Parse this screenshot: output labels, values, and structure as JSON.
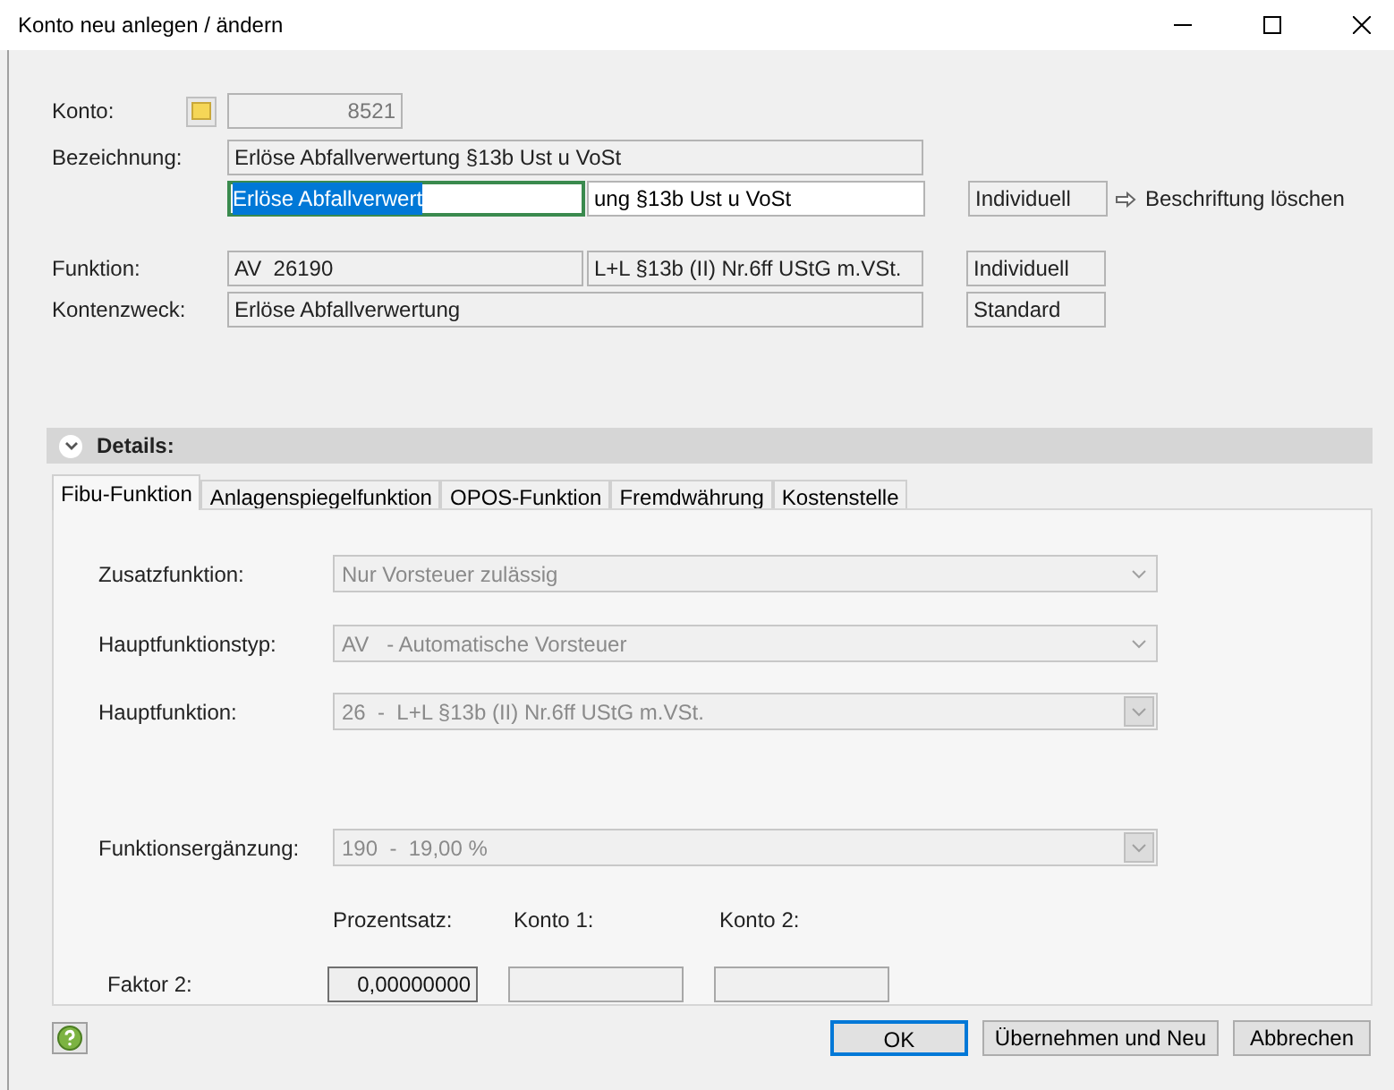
{
  "window": {
    "title": "Konto neu anlegen / ändern"
  },
  "konto": {
    "label": "Konto:",
    "value": "8521"
  },
  "bezeichnung": {
    "label": "Bezeichnung:",
    "value": "Erlöse Abfallverwertung §13b Ust u VoSt",
    "edit_selected": "Erlöse Abfallverwert",
    "edit_rest": "ung §13b Ust u VoSt",
    "mode": "Individuell",
    "clear_link": "Beschriftung löschen"
  },
  "funktion": {
    "label": "Funktion:",
    "code": "AV  26190",
    "text": "L+L §13b (II) Nr.6ff UStG m.VSt.",
    "mode": "Individuell"
  },
  "kontenzweck": {
    "label": "Kontenzweck:",
    "value": "Erlöse Abfallverwertung",
    "mode": "Standard"
  },
  "details": {
    "title": "Details:",
    "expanded": true,
    "tabs": [
      {
        "label": "Fibu-Funktion",
        "selected": true
      },
      {
        "label": "Anlagenspiegelfunktion",
        "selected": false
      },
      {
        "label": "OPOS-Funktion",
        "selected": false
      },
      {
        "label": "Fremdwährung",
        "selected": false
      },
      {
        "label": "Kostenstelle",
        "selected": false
      }
    ],
    "fields": [
      {
        "label": "Zusatzfunktion:",
        "value": "Nur Vorsteuer zulässig",
        "kind": "plain"
      },
      {
        "label": "Hauptfunktionstyp:",
        "value": "AV   - Automatische Vorsteuer",
        "kind": "plain"
      },
      {
        "label": "Hauptfunktion:",
        "value": "26  -  L+L §13b (II) Nr.6ff UStG m.VSt.",
        "kind": "button"
      },
      {
        "label": "Funktionsergänzung:",
        "value": "190  -  19,00 %",
        "kind": "button"
      }
    ],
    "factor": {
      "label": "Faktor 2:",
      "inputs": [
        {
          "column": "Prozentsatz:",
          "value": "0,00000000"
        },
        {
          "column": "Konto 1:"
        },
        {
          "column": "Konto 2:"
        }
      ]
    }
  },
  "buttons": [
    {
      "label": "OK",
      "default": true
    },
    {
      "label": "Übernehmen und Neu",
      "default": false
    },
    {
      "label": "Abbrechen",
      "default": false
    }
  ]
}
